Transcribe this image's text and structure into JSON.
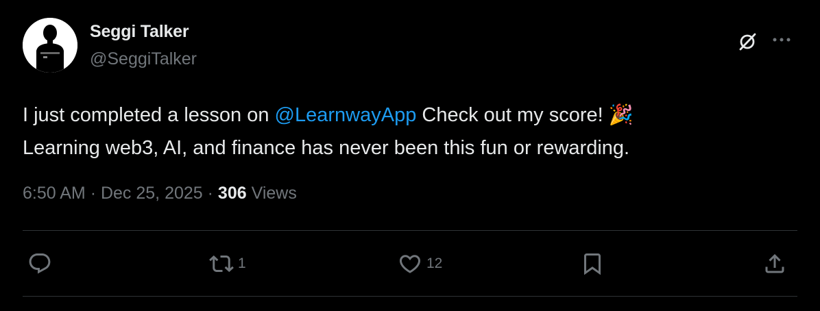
{
  "author": {
    "display_name": "Seggi Talker",
    "handle": "@SeggiTalker",
    "avatar_icon": "avatar-silhouette"
  },
  "tweet": {
    "text_before_mention": "I just completed a lesson on ",
    "mention": "@LearnwayApp",
    "text_after_mention": " Check out my score! ",
    "emoji": "🎉",
    "second_line": "Learning web3, AI, and finance has never been this fun or rewarding."
  },
  "meta": {
    "time": "6:50 AM",
    "separator": "·",
    "date": "Dec 25, 2025",
    "views_count": "306",
    "views_label": "Views"
  },
  "actions": {
    "replies": {
      "icon": "reply-icon",
      "count": ""
    },
    "reposts": {
      "icon": "repost-icon",
      "count": "1"
    },
    "likes": {
      "icon": "like-icon",
      "count": "12"
    },
    "bookmark": {
      "icon": "bookmark-icon"
    },
    "share": {
      "icon": "share-icon"
    }
  },
  "header_icons": [
    "grok-icon",
    "more-icon"
  ],
  "colors": {
    "background": "#000000",
    "primary_text": "#e7e9ea",
    "secondary_text": "#71767b",
    "accent": "#1d9bf0",
    "divider": "#2f3336"
  }
}
